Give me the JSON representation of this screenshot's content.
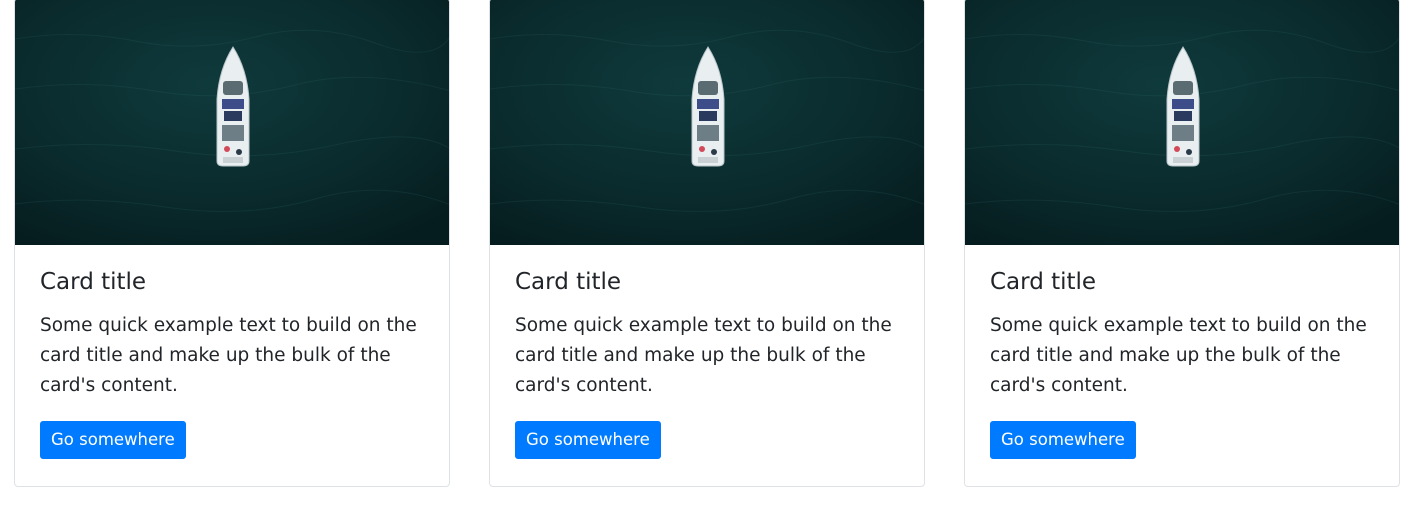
{
  "cards": [
    {
      "title": "Card title",
      "text": "Some quick example text to build on the card title and make up the bulk of the card's content.",
      "button_label": "Go somewhere",
      "image_icon": "boat-aerial-photo"
    },
    {
      "title": "Card title",
      "text": "Some quick example text to build on the card title and make up the bulk of the card's content.",
      "button_label": "Go somewhere",
      "image_icon": "boat-aerial-photo"
    },
    {
      "title": "Card title",
      "text": "Some quick example text to build on the card title and make up the bulk of the card's content.",
      "button_label": "Go somewhere",
      "image_icon": "boat-aerial-photo"
    }
  ],
  "colors": {
    "primary_button": "#007bff",
    "button_text": "#ffffff",
    "water": "#0b2a2c",
    "card_border": "#dee2e6"
  }
}
